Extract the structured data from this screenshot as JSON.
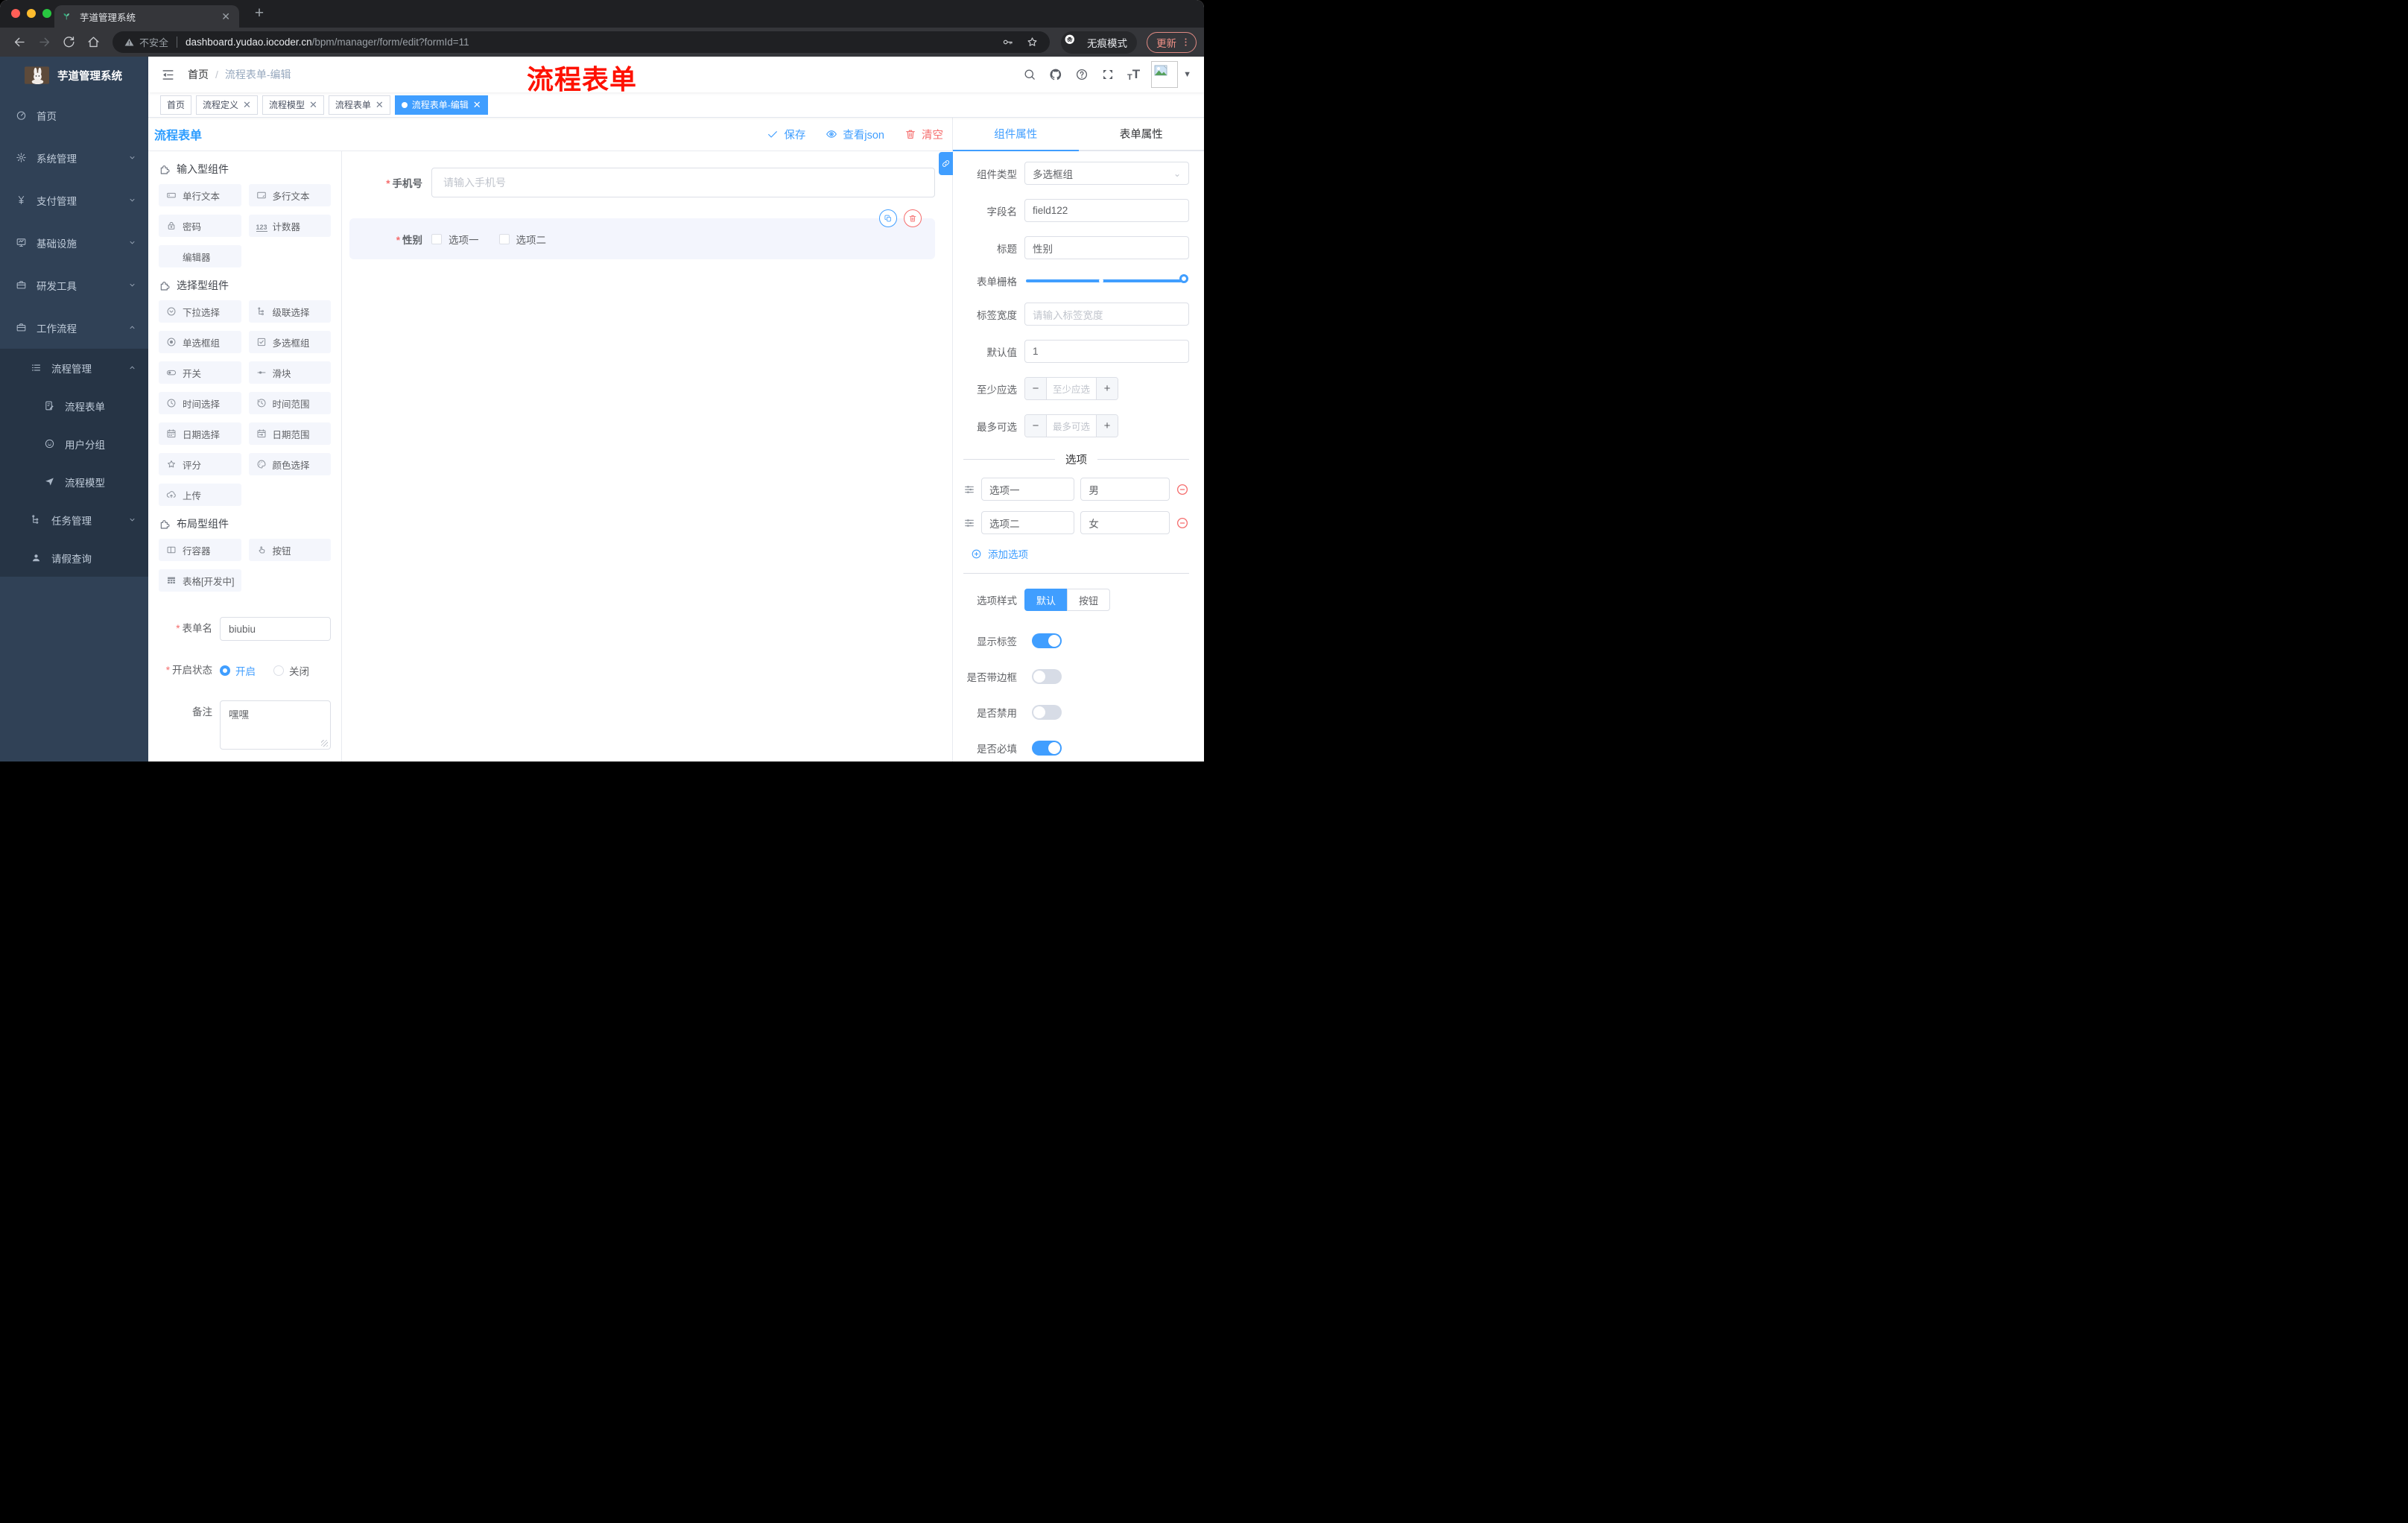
{
  "colors": {
    "accent": "#409eff",
    "danger": "#f56c6c",
    "sidebar_bg": "#304156",
    "sidebar_sub_bg": "#263445",
    "annotation_red": "#fe1100"
  },
  "browser": {
    "tab_title": "芋道管理系统",
    "security_label": "不安全",
    "url_domain": "dashboard.yudao.iocoder.cn",
    "url_path": "/bpm/manager/form/edit?formId=11",
    "incognito_label": "无痕模式",
    "update_label": "更新"
  },
  "annotation": {
    "text": "流程表单"
  },
  "sidebar": {
    "logo_title": "芋道管理系统",
    "items": [
      {
        "label": "首页",
        "icon": "dashboard-icon",
        "level": 1,
        "chevron": null,
        "submenu": false
      },
      {
        "label": "系统管理",
        "icon": "gear-icon",
        "level": 1,
        "chevron": "down",
        "submenu": false
      },
      {
        "label": "支付管理",
        "icon": "yen-icon",
        "level": 1,
        "chevron": "down",
        "submenu": false
      },
      {
        "label": "基础设施",
        "icon": "monitor-icon",
        "level": 1,
        "chevron": "down",
        "submenu": false
      },
      {
        "label": "研发工具",
        "icon": "briefcase-icon",
        "level": 1,
        "chevron": "down",
        "submenu": false
      },
      {
        "label": "工作流程",
        "icon": "briefcase-icon",
        "level": 1,
        "chevron": "up",
        "submenu": false
      },
      {
        "label": "流程管理",
        "icon": "list-tree-icon",
        "level": 2,
        "chevron": "up",
        "submenu": true
      },
      {
        "label": "流程表单",
        "icon": "form-doc-icon",
        "level": 3,
        "chevron": null,
        "submenu": true
      },
      {
        "label": "用户分组",
        "icon": "user-group-icon",
        "level": 3,
        "chevron": null,
        "submenu": true
      },
      {
        "label": "流程模型",
        "icon": "paper-plane-icon",
        "level": 3,
        "chevron": null,
        "submenu": true
      },
      {
        "label": "任务管理",
        "icon": "tree-icon",
        "level": 2,
        "chevron": "down",
        "submenu": true
      },
      {
        "label": "请假查询",
        "icon": "person-icon",
        "level": 2,
        "chevron": null,
        "submenu": true
      }
    ]
  },
  "header": {
    "breadcrumb_root": "首页",
    "breadcrumb_current": "流程表单-编辑"
  },
  "tags": [
    {
      "label": "首页",
      "closable": false,
      "active": false
    },
    {
      "label": "流程定义",
      "closable": true,
      "active": false
    },
    {
      "label": "流程模型",
      "closable": true,
      "active": false
    },
    {
      "label": "流程表单",
      "closable": true,
      "active": false
    },
    {
      "label": "流程表单-编辑",
      "closable": true,
      "active": true
    }
  ],
  "designer": {
    "title": "流程表单",
    "save_label": "保存",
    "view_json_label": "查看json",
    "clear_label": "清空"
  },
  "palette": {
    "sections": [
      {
        "title": "输入型组件",
        "items": [
          {
            "label": "单行文本",
            "icon": "input-icon"
          },
          {
            "label": "多行文本",
            "icon": "textarea-icon"
          },
          {
            "label": "密码",
            "icon": "lock-icon"
          },
          {
            "label": "计数器",
            "icon": "number-icon"
          },
          {
            "label": "编辑器",
            "icon": null
          }
        ]
      },
      {
        "title": "选择型组件",
        "items": [
          {
            "label": "下拉选择",
            "icon": "select-icon"
          },
          {
            "label": "级联选择",
            "icon": "cascader-icon"
          },
          {
            "label": "单选框组",
            "icon": "radio-icon"
          },
          {
            "label": "多选框组",
            "icon": "checkbox-icon"
          },
          {
            "label": "开关",
            "icon": "switch-icon"
          },
          {
            "label": "滑块",
            "icon": "slider-icon"
          },
          {
            "label": "时间选择",
            "icon": "time-icon"
          },
          {
            "label": "时间范围",
            "icon": "time-range-icon"
          },
          {
            "label": "日期选择",
            "icon": "date-icon"
          },
          {
            "label": "日期范围",
            "icon": "date-range-icon"
          },
          {
            "label": "评分",
            "icon": "star-icon"
          },
          {
            "label": "颜色选择",
            "icon": "color-icon"
          },
          {
            "label": "上传",
            "icon": "upload-icon"
          }
        ]
      },
      {
        "title": "布局型组件",
        "items": [
          {
            "label": "行容器",
            "icon": "row-icon"
          },
          {
            "label": "按钮",
            "icon": "button-icon"
          },
          {
            "label": "表格[开发中]",
            "icon": "table-icon"
          }
        ]
      }
    ],
    "form": {
      "name_label": "表单名",
      "name_value": "biubiu",
      "status_label": "开启状态",
      "status_on_label": "开启",
      "status_off_label": "关闭",
      "remark_label": "备注",
      "remark_value": "嘿嘿"
    }
  },
  "canvas": {
    "phone_label": "手机号",
    "phone_placeholder": "请输入手机号",
    "gender_label": "性别",
    "gender_options": [
      "选项一",
      "选项二"
    ]
  },
  "inspector": {
    "tab_component": "组件属性",
    "tab_form": "表单属性",
    "rows": {
      "component_type_label": "组件类型",
      "component_type_value": "多选框组",
      "field_name_label": "字段名",
      "field_name_value": "field122",
      "title_label": "标题",
      "title_value": "性别",
      "grid_label": "表单栅格",
      "label_width_label": "标签宽度",
      "label_width_placeholder": "请输入标签宽度",
      "default_label": "默认值",
      "default_value": "1",
      "min_label": "至少应选",
      "min_placeholder": "至少应选",
      "max_label": "最多可选",
      "max_placeholder": "最多可选"
    },
    "options_title": "选项",
    "options": [
      {
        "label": "选项一",
        "value": "男"
      },
      {
        "label": "选项二",
        "value": "女"
      }
    ],
    "add_option_label": "添加选项",
    "style_label": "选项样式",
    "style_default": "默认",
    "style_button": "按钮",
    "toggles": [
      {
        "label": "显示标签",
        "on": true
      },
      {
        "label": "是否带边框",
        "on": false
      },
      {
        "label": "是否禁用",
        "on": false
      },
      {
        "label": "是否必填",
        "on": true
      }
    ]
  }
}
